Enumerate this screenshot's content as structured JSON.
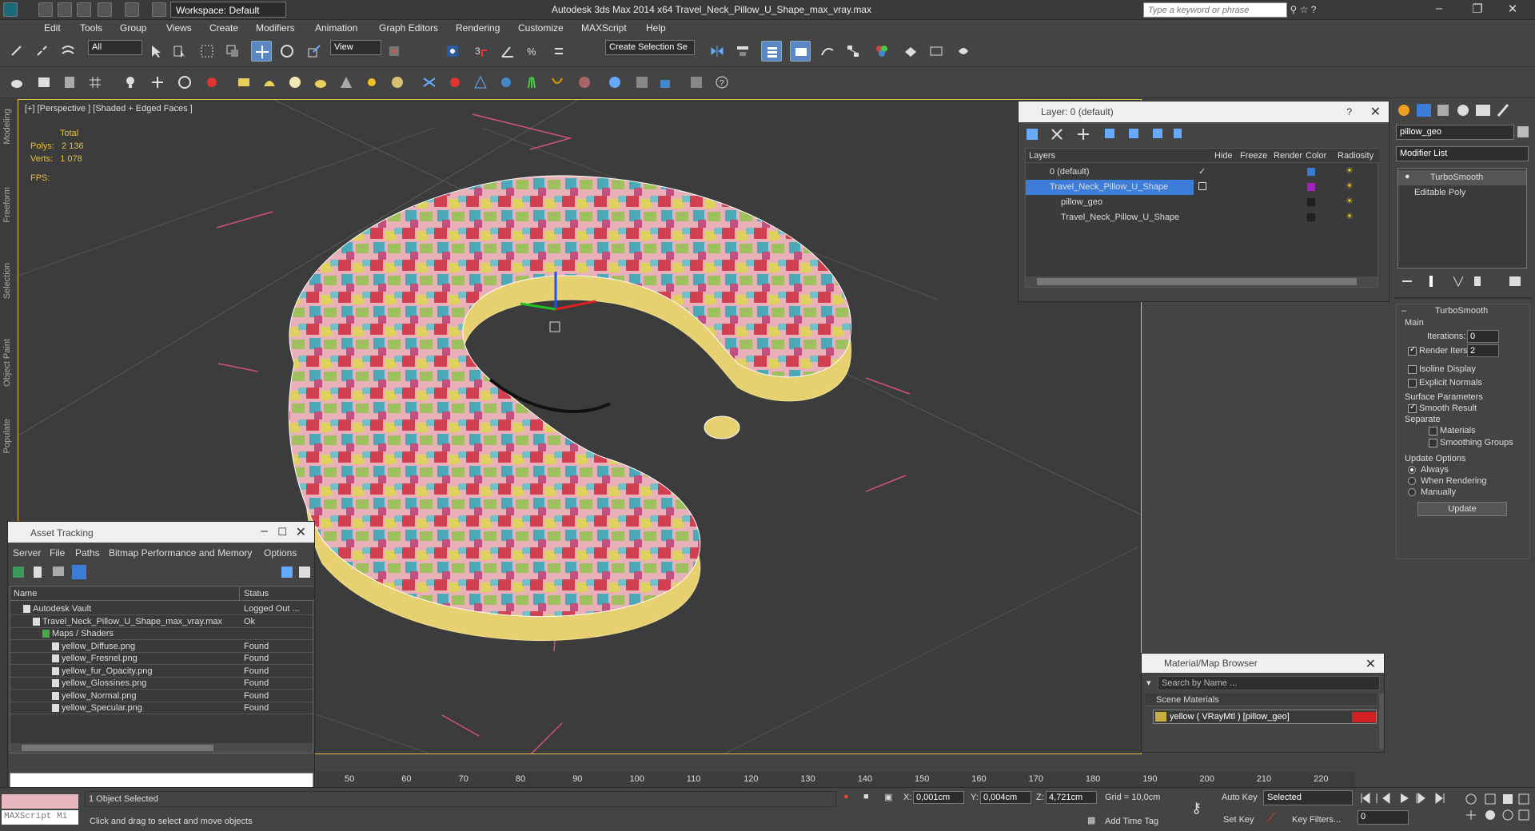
{
  "app": {
    "title": "Autodesk 3ds Max  2014 x64     Travel_Neck_Pillow_U_Shape_max_vray.max",
    "workspace": "Workspace: Default",
    "search_placeholder": "Type a keyword or phrase"
  },
  "menu": [
    "Edit",
    "Tools",
    "Group",
    "Views",
    "Create",
    "Modifiers",
    "Animation",
    "Graph Editors",
    "Rendering",
    "Customize",
    "MAXScript",
    "Help"
  ],
  "toolbar": {
    "selection_filter": "All",
    "ref_coord": "View",
    "named_selection": "Create Selection Se"
  },
  "sidebar_tabs": [
    "Modeling",
    "Freeform",
    "Selection",
    "Object Paint",
    "Populate"
  ],
  "viewport": {
    "label": "[+] [Perspective ] [Shaded + Edged Faces ]",
    "stats_total": "Total",
    "polys_label": "Polys:",
    "polys": "2 136",
    "verts_label": "Verts:",
    "verts": "1 078",
    "fps_label": "FPS:"
  },
  "layer_panel": {
    "title": "Layer: 0 (default)",
    "columns": [
      "Layers",
      "Hide",
      "Freeze",
      "Render",
      "Color",
      "Radiosity"
    ],
    "rows": [
      {
        "name": "0 (default)",
        "color": "#3a7ad0"
      },
      {
        "name": "Travel_Neck_Pillow_U_Shape",
        "color": "#a020c0",
        "selected": true
      },
      {
        "name": "pillow_geo",
        "color": "#202020"
      },
      {
        "name": "Travel_Neck_Pillow_U_Shape",
        "color": "#202020"
      }
    ]
  },
  "asset_tracking": {
    "title": "Asset Tracking",
    "menu": [
      "Server",
      "File",
      "Paths",
      "Bitmap Performance and Memory",
      "Options"
    ],
    "col_name": "Name",
    "col_status": "Status",
    "rows": [
      {
        "name": "Autodesk Vault",
        "status": "Logged Out ...",
        "indent": 1
      },
      {
        "name": "Travel_Neck_Pillow_U_Shape_max_vray.max",
        "status": "Ok",
        "indent": 2
      },
      {
        "name": "Maps / Shaders",
        "status": "",
        "indent": 3
      },
      {
        "name": "yellow_Diffuse.png",
        "status": "Found",
        "indent": 4
      },
      {
        "name": "yellow_Fresnel.png",
        "status": "Found",
        "indent": 4
      },
      {
        "name": "yellow_fur_Opacity.png",
        "status": "Found",
        "indent": 4
      },
      {
        "name": "yellow_Glossines.png",
        "status": "Found",
        "indent": 4
      },
      {
        "name": "yellow_Normal.png",
        "status": "Found",
        "indent": 4
      },
      {
        "name": "yellow_Specular.png",
        "status": "Found",
        "indent": 4
      }
    ]
  },
  "material_browser": {
    "title": "Material/Map Browser",
    "search_placeholder": "Search by Name ...",
    "section": "Scene Materials",
    "item": "yellow  ( VRayMtl )  [pillow_geo]"
  },
  "command_panel": {
    "object_name": "pillow_geo",
    "modifier_list": "Modifier List",
    "stack": [
      "TurboSmooth",
      "Editable Poly"
    ],
    "rollout": "TurboSmooth",
    "main": "Main",
    "iterations_label": "Iterations:",
    "iterations": "0",
    "render_iters_label": "Render Iters:",
    "render_iters": "2",
    "isoline": "Isoline Display",
    "explicit_normals": "Explicit Normals",
    "surface_params": "Surface Parameters",
    "smooth_result": "Smooth Result",
    "separate": "Separate",
    "materials": "Materials",
    "smoothing_groups": "Smoothing Groups",
    "update_options": "Update Options",
    "always": "Always",
    "when_rendering": "When Rendering",
    "manually": "Manually",
    "update_btn": "Update"
  },
  "timeline_ticks": [
    "50",
    "60",
    "70",
    "80",
    "90",
    "100",
    "110",
    "120",
    "130",
    "140",
    "150",
    "160",
    "170",
    "180",
    "190",
    "200",
    "210",
    "220"
  ],
  "status": {
    "maxscript": "MAXScript Mi",
    "selected": "1 Object Selected",
    "prompt": "Click and drag to select and move objects",
    "x_label": "X:",
    "x": "0,001cm",
    "y_label": "Y:",
    "y": "0,004cm",
    "z_label": "Z:",
    "z": "4,721cm",
    "grid": "Grid = 10,0cm",
    "add_time_tag": "Add Time Tag",
    "auto_key": "Auto Key",
    "auto_key_sel": "Selected",
    "set_key": "Set Key",
    "key_filters": "Key Filters...",
    "frame": "0"
  }
}
